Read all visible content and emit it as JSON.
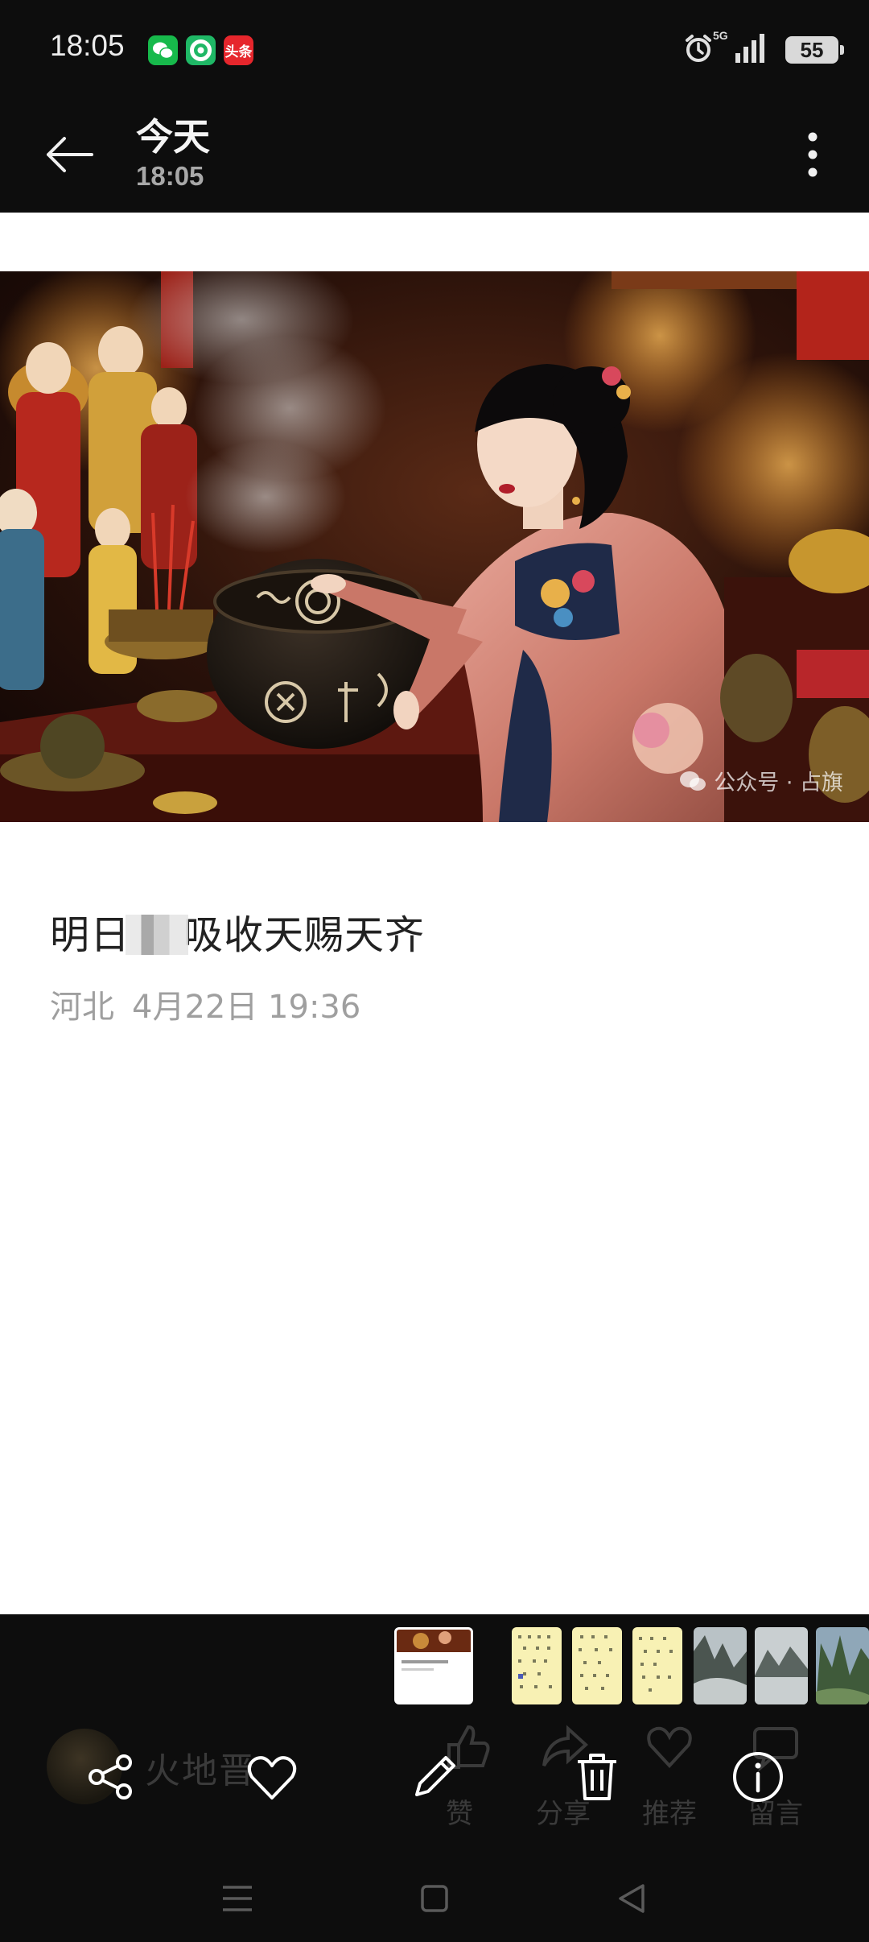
{
  "status_bar": {
    "time": "18:05",
    "notification_apps": [
      "wechat-icon",
      "ring-app-icon",
      "toutiao-icon"
    ],
    "toutiao_label": "头条",
    "network_label": "5G",
    "battery": "55"
  },
  "header": {
    "title": "今天",
    "subtitle": "18:05"
  },
  "content": {
    "watermark": "公众号 · 占旗",
    "title_start": "明日",
    "title_end": "吸收天赐天齐",
    "location": "河北",
    "date": "4月22日 19:36"
  },
  "thumbnails": [
    "current-article",
    "doc-1",
    "doc-2",
    "doc-3",
    "mountain-1",
    "mountain-2",
    "mountain-3"
  ],
  "background_overlay": {
    "name": "火地晋",
    "like": "赞",
    "share": "分享",
    "recommend": "推荐",
    "comment": "留言"
  },
  "actions": [
    "share-icon",
    "favorite-icon",
    "edit-icon",
    "delete-icon",
    "info-icon"
  ],
  "colors": {
    "bar_background": "#0d0d0d",
    "content_background": "#ffffff",
    "title_text": "#222222",
    "meta_text": "#9f9f9f"
  }
}
